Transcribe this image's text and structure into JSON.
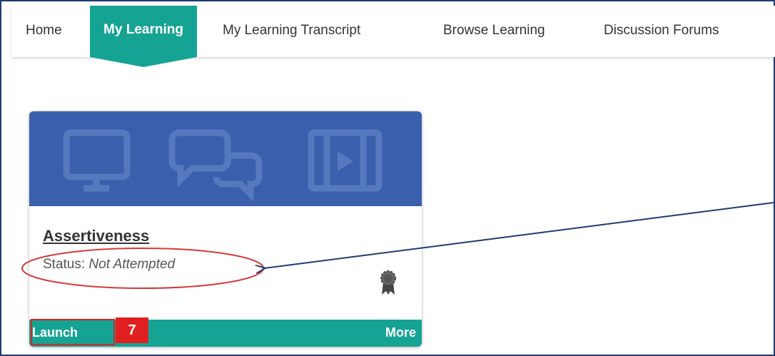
{
  "nav": {
    "items": [
      {
        "label": "Home"
      },
      {
        "label": "My Learning"
      },
      {
        "label": "My Learning Transcript"
      },
      {
        "label": "Browse Learning"
      },
      {
        "label": "Discussion Forums"
      }
    ]
  },
  "card": {
    "title": "Assertiveness",
    "status_label": "Status: ",
    "status_value": "Not Attempted",
    "launch_label": "Launch",
    "more_label": "More",
    "banner_color": "#3a5fad",
    "icons": [
      "monitor-icon",
      "chat-bubbles-icon",
      "video-player-icon"
    ],
    "badge_icon": "award-ribbon-icon"
  },
  "annotation": {
    "step_number": "7",
    "accent": "#e02020",
    "arrow_color": "#1f3b73"
  },
  "colors": {
    "teal": "#15a394"
  }
}
